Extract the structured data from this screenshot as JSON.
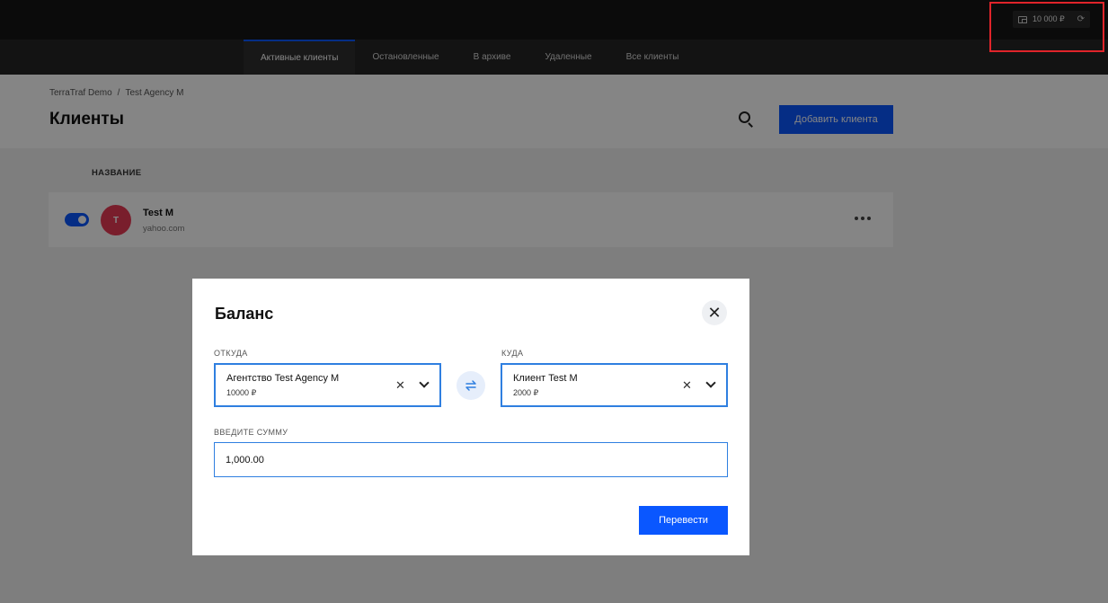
{
  "topbar": {
    "balance": "10 000 ₽",
    "wallet_icon": "wallet-icon",
    "refresh_icon": "refresh-icon"
  },
  "nav": {
    "tabs": [
      {
        "label": "Активные клиенты",
        "active": true
      },
      {
        "label": "Остановленные",
        "active": false
      },
      {
        "label": "В архиве",
        "active": false
      },
      {
        "label": "Удаленные",
        "active": false
      },
      {
        "label": "Все клиенты",
        "active": false
      }
    ]
  },
  "header": {
    "breadcrumb": [
      "TerraTraf Demo",
      "Test Agency M"
    ],
    "breadcrumb_sep": "/",
    "title": "Клиенты",
    "add_button": "Добавить клиента"
  },
  "table": {
    "column_name": "НАЗВАНИЕ",
    "rows": [
      {
        "avatar": "T",
        "name": "Test M",
        "email": "yahoo.com",
        "enabled": true
      }
    ]
  },
  "modal": {
    "title": "Баланс",
    "from_label": "ОТКУДА",
    "from_main": "Агентство Test Agency M",
    "from_sub": "10000 ₽",
    "to_label": "КУДА",
    "to_main": "Клиент Test M",
    "to_sub": "2000 ₽",
    "amount_label": "ВВЕДИТЕ СУММУ",
    "amount_value": "1,000.00",
    "submit": "Перевести",
    "clear_glyph": "✕",
    "close_glyph": "✕"
  },
  "colors": {
    "accent": "#0a57ff",
    "avatar": "#e83a55",
    "highlight": "#e0242a"
  }
}
